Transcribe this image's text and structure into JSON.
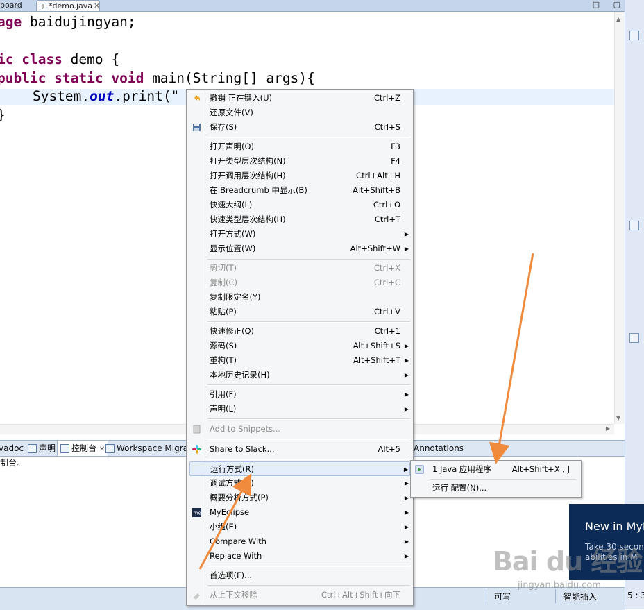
{
  "editor_tabs": [
    {
      "label": "board"
    },
    {
      "label": "*demo.java"
    }
  ],
  "window_controls": "□ ▢",
  "code": {
    "line1": {
      "kw": "age",
      "rest": " baidujingyan;"
    },
    "line2": {
      "kw": "ic class",
      "rest": " demo {"
    },
    "line3": {
      "kw": "public static void",
      "rest": " main(String[] args){"
    },
    "line4": {
      "pre": "    System.",
      "fld": "out",
      "post": ".print(\""
    },
    "line5": {
      "text": "}"
    }
  },
  "context_menu": {
    "items": [
      {
        "label": "撤销 正在键入(U)",
        "shortcut": "Ctrl+Z"
      },
      {
        "label": "还原文件(V)",
        "shortcut": ""
      },
      {
        "label": "保存(S)",
        "shortcut": "Ctrl+S"
      },
      {
        "label": "打开声明(O)",
        "shortcut": "F3"
      },
      {
        "label": "打开类型层次结构(N)",
        "shortcut": "F4"
      },
      {
        "label": "打开调用层次结构(H)",
        "shortcut": "Ctrl+Alt+H"
      },
      {
        "label": "在 Breadcrumb 中显示(B)",
        "shortcut": "Alt+Shift+B"
      },
      {
        "label": "快速大纲(L)",
        "shortcut": "Ctrl+O"
      },
      {
        "label": "快速类型层次结构(H)",
        "shortcut": "Ctrl+T"
      },
      {
        "label": "打开方式(W)",
        "shortcut": ""
      },
      {
        "label": "显示位置(W)",
        "shortcut": "Alt+Shift+W"
      },
      {
        "label": "剪切(T)",
        "shortcut": "Ctrl+X"
      },
      {
        "label": "复制(C)",
        "shortcut": "Ctrl+C"
      },
      {
        "label": "复制限定名(Y)",
        "shortcut": ""
      },
      {
        "label": "粘贴(P)",
        "shortcut": "Ctrl+V"
      },
      {
        "label": "快速修正(Q)",
        "shortcut": "Ctrl+1"
      },
      {
        "label": "源码(S)",
        "shortcut": "Alt+Shift+S"
      },
      {
        "label": "重构(T)",
        "shortcut": "Alt+Shift+T"
      },
      {
        "label": "本地历史记录(H)",
        "shortcut": ""
      },
      {
        "label": "引用(F)",
        "shortcut": ""
      },
      {
        "label": "声明(L)",
        "shortcut": ""
      },
      {
        "label": "Add to Snippets...",
        "shortcut": ""
      },
      {
        "label": "Share to Slack...",
        "shortcut": "Alt+5"
      },
      {
        "label": "运行方式(R)",
        "shortcut": ""
      },
      {
        "label": "调试方式(D)",
        "shortcut": ""
      },
      {
        "label": "概要分析方式(P)",
        "shortcut": ""
      },
      {
        "label": "MyEclipse",
        "shortcut": ""
      },
      {
        "label": "小组(E)",
        "shortcut": ""
      },
      {
        "label": "Compare With",
        "shortcut": ""
      },
      {
        "label": "Replace With",
        "shortcut": ""
      },
      {
        "label": "首选项(F)...",
        "shortcut": ""
      },
      {
        "label": "从上下文移除",
        "shortcut": "Ctrl+Alt+Shift+向下"
      }
    ]
  },
  "submenu": {
    "items": [
      {
        "label": "1 Java 应用程序",
        "shortcut": "Alt+Shift+X , J"
      },
      {
        "label": "运行 配置(N)...",
        "shortcut": ""
      }
    ]
  },
  "views": {
    "tabs": [
      {
        "label": "vadoc"
      },
      {
        "label": "声明"
      },
      {
        "label": "控制台"
      },
      {
        "label": "Workspace Migra"
      },
      {
        "label": "Annotations"
      }
    ],
    "console_text": "制台。"
  },
  "promo": {
    "title": "New in MyE",
    "line1": "Take 30 second",
    "line2": "abilities in M"
  },
  "status": {
    "mode": "可写",
    "insert": "智能插入",
    "position": "5 : 3"
  },
  "watermark": {
    "text": "Bai du 经验",
    "url": "jingyan.baidu.com"
  },
  "colors": {
    "keyword": "#7f0055",
    "field": "#0000c0",
    "arrow": "#f08a3c",
    "menu_bg": "#f5f6f7",
    "selection": "#e4eefb"
  }
}
